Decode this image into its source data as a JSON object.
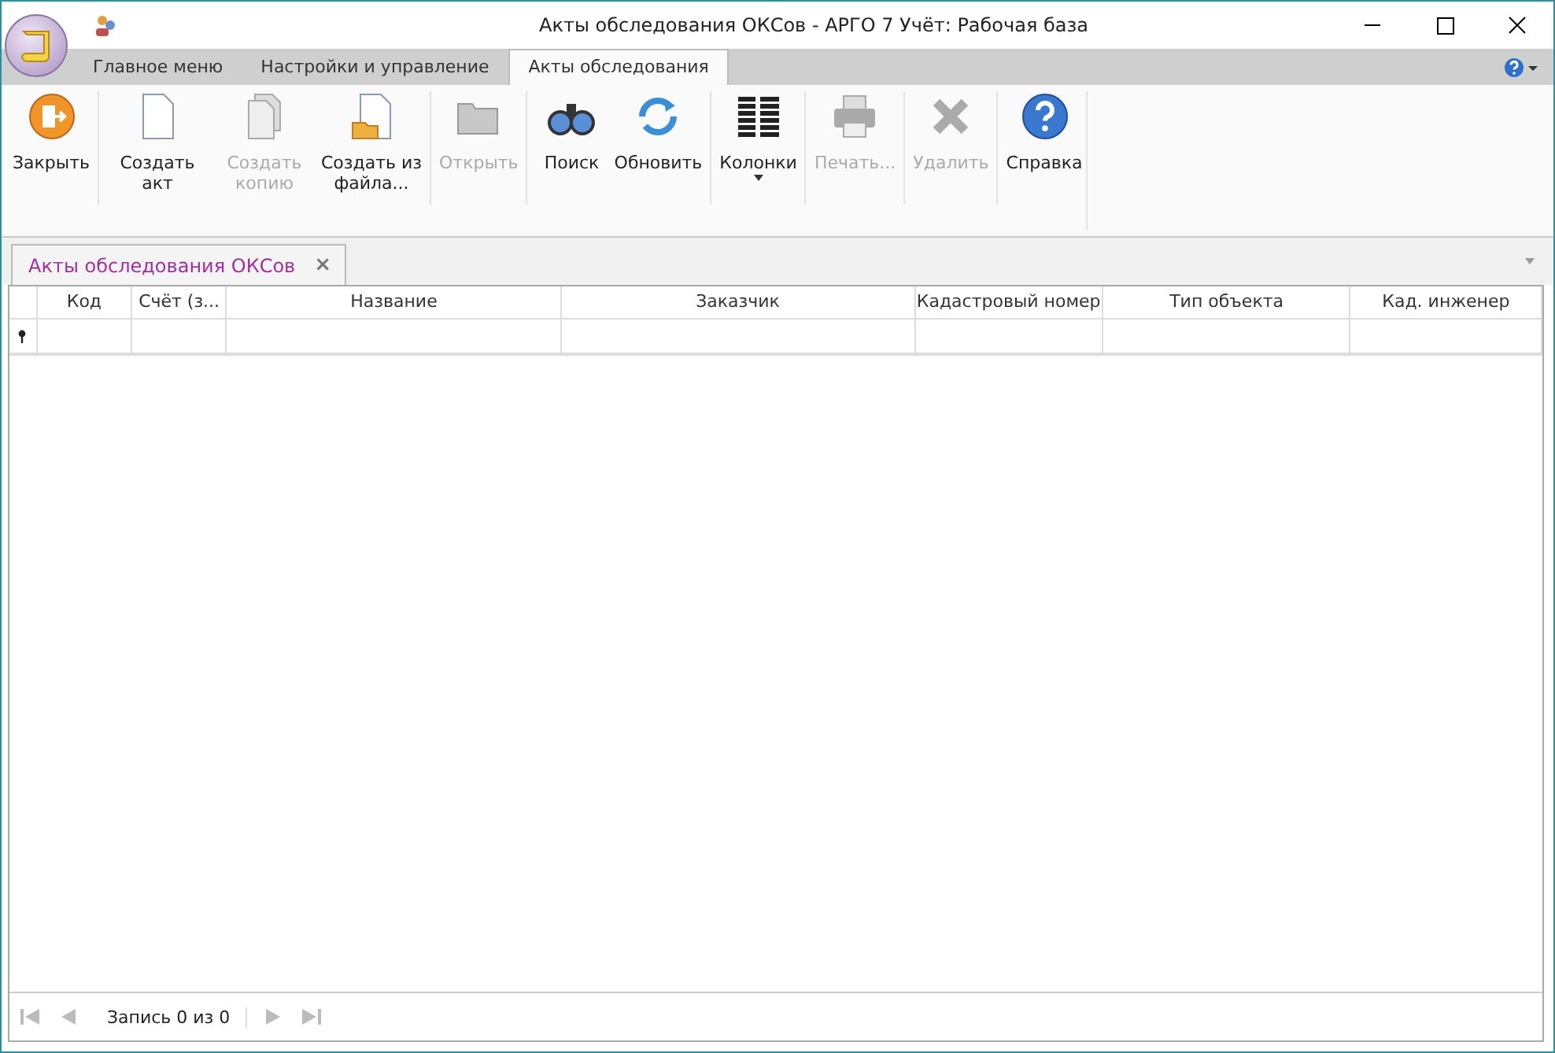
{
  "window": {
    "title": "Акты обследования ОКСов - АРГО 7 Учёт: Рабочая база"
  },
  "ribbon_tabs": [
    {
      "label": "Главное меню",
      "selected": false
    },
    {
      "label": "Настройки и управление",
      "selected": false
    },
    {
      "label": "Акты обследования",
      "selected": true
    }
  ],
  "toolbar": {
    "groups": [
      [
        {
          "label": "Закрыть",
          "kind": "close",
          "disabled": false
        }
      ],
      [
        {
          "label": "Создать акт",
          "kind": "new",
          "disabled": false
        },
        {
          "label": "Создать копию",
          "kind": "copy",
          "disabled": true
        },
        {
          "label": "Создать из файла...",
          "kind": "from_file",
          "disabled": false
        }
      ],
      [
        {
          "label": "Открыть",
          "kind": "open",
          "disabled": true
        }
      ],
      [
        {
          "label": "Поиск",
          "kind": "search",
          "disabled": false
        },
        {
          "label": "Обновить",
          "kind": "refresh",
          "disabled": false
        }
      ],
      [
        {
          "label": "Колонки",
          "kind": "columns",
          "disabled": false,
          "dropdown": true
        }
      ],
      [
        {
          "label": "Печать...",
          "kind": "print",
          "disabled": true
        }
      ],
      [
        {
          "label": "Удалить",
          "kind": "delete",
          "disabled": true
        }
      ],
      [
        {
          "label": "Справка",
          "kind": "help",
          "disabled": false
        }
      ]
    ]
  },
  "document_tab": {
    "label": "Акты обследования ОКСов",
    "close": "×"
  },
  "table": {
    "columns": [
      "Код",
      "Счёт (з...",
      "Название",
      "Заказчик",
      "Кадастровый номер",
      "Тип объекта",
      "Кад. инженер"
    ]
  },
  "status_bar": {
    "record": "Запись 0 из 0"
  }
}
